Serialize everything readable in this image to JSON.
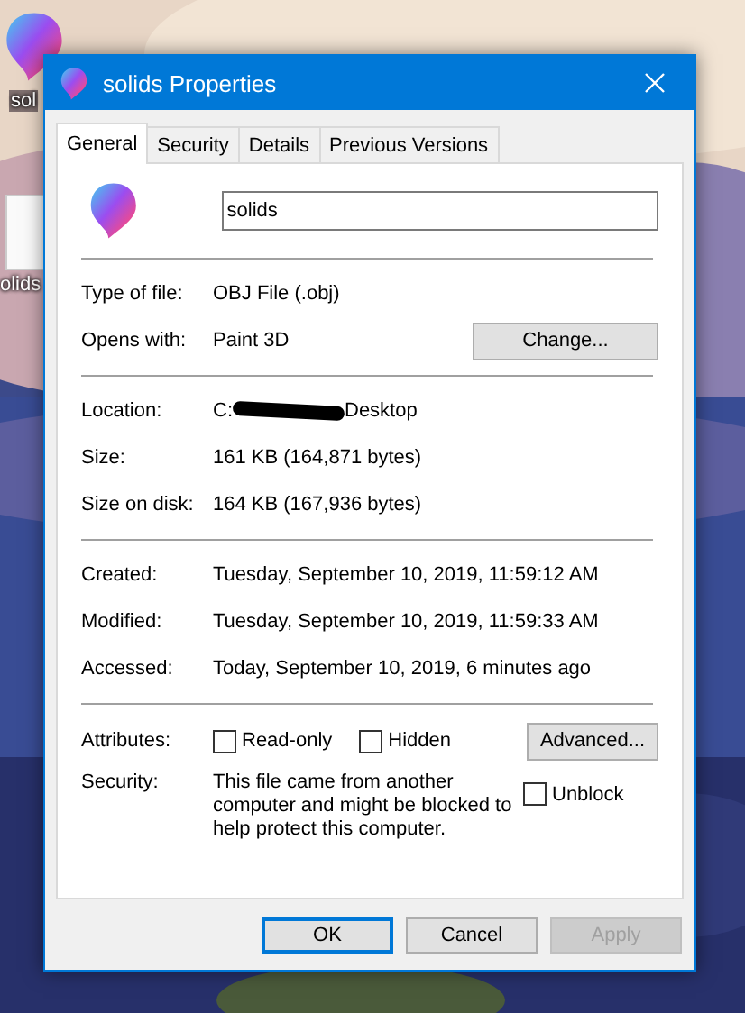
{
  "desktop_icons": [
    {
      "kind": "paint3d",
      "label": "sol"
    },
    {
      "kind": "file",
      "label": "olids"
    }
  ],
  "window": {
    "title": "solids Properties"
  },
  "tabs": [
    {
      "label": "General",
      "selected": true
    },
    {
      "label": "Security",
      "selected": false
    },
    {
      "label": "Details",
      "selected": false
    },
    {
      "label": "Previous Versions",
      "selected": false
    }
  ],
  "name_field": {
    "value": "solids"
  },
  "file_info": [
    {
      "label": "Type of file:",
      "value": "OBJ File (.obj)"
    },
    {
      "label": "Opens with:",
      "value": "Paint 3D",
      "button": "Change..."
    }
  ],
  "location": {
    "label": "Location:",
    "start": "C:",
    "end": "Desktop",
    "redacted": true
  },
  "sizes": [
    {
      "label": "Size:",
      "value": "161 KB (164,871 bytes)"
    },
    {
      "label": "Size on disk:",
      "value": "164 KB (167,936 bytes)"
    }
  ],
  "dates": [
    {
      "label": "Created:",
      "value": "Tuesday, September 10, 2019, 11:59:12 AM"
    },
    {
      "label": "Modified:",
      "value": "Tuesday, September 10, 2019, 11:59:33 AM"
    },
    {
      "label": "Accessed:",
      "value": "Today, September 10, 2019, 6 minutes ago"
    }
  ],
  "attributes": {
    "label": "Attributes:",
    "checkboxes": [
      {
        "label": "Read-only",
        "checked": false
      },
      {
        "label": "Hidden",
        "checked": false
      }
    ],
    "button": "Advanced..."
  },
  "security": {
    "label": "Security:",
    "text": "This file came from another computer and might be blocked to help protect this computer.",
    "checkbox": {
      "label": "Unblock",
      "checked": false
    }
  },
  "buttons": [
    {
      "label": "OK",
      "default": true,
      "disabled": false
    },
    {
      "label": "Cancel",
      "default": false,
      "disabled": false
    },
    {
      "label": "Apply",
      "default": false,
      "disabled": true
    }
  ]
}
